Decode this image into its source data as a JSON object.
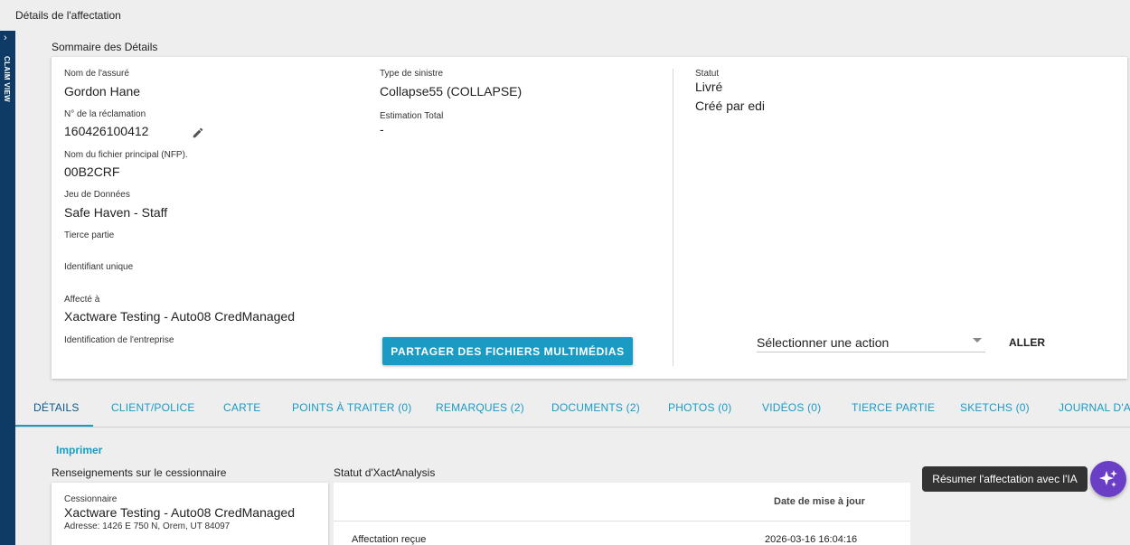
{
  "page": {
    "title": "Détails de l'affectation"
  },
  "side_rail": {
    "label": "CLAIM VIEW"
  },
  "summary": {
    "title": "Sommaire des Détails",
    "fields": {
      "insured_name": {
        "label": "Nom de l'assuré",
        "value": "Gordon Hane"
      },
      "claim_number": {
        "label": "N° de la réclamation",
        "value": "160426100412"
      },
      "nfp": {
        "label": "Nom du fichier principal (NFP).",
        "value": "00B2CRF"
      },
      "dataset": {
        "label": "Jeu de Données",
        "value": "Safe Haven - Staff"
      },
      "third_party": {
        "label": "Tierce partie",
        "value": ""
      },
      "unique_id": {
        "label": "Identifiant unique",
        "value": ""
      },
      "assigned_to": {
        "label": "Affecté à",
        "value": "Xactware Testing - Auto08 CredManaged"
      },
      "company_id": {
        "label": "Identification de l'entreprise",
        "value": ""
      },
      "loss_type": {
        "label": "Type de sinistre",
        "value": "Collapse55 (COLLAPSE)"
      },
      "estimate_total": {
        "label": "Estimation Total",
        "value": "-"
      },
      "status": {
        "label": "Statut",
        "value": "Livré"
      },
      "created_by": "Créé par edi"
    },
    "share_button": "PARTAGER DES FICHIERS MULTIMÉDIAS",
    "action_select": {
      "value": "Sélectionner une action"
    },
    "go_button": "ALLER"
  },
  "tabs": [
    {
      "label": "DÉTAILS",
      "active": true
    },
    {
      "label": "CLIENT/POLICE"
    },
    {
      "label": "CARTE"
    },
    {
      "label": "POINTS À TRAITER (0)"
    },
    {
      "label": "REMARQUES (2)"
    },
    {
      "label": "DOCUMENTS (2)"
    },
    {
      "label": "PHOTOS (0)"
    },
    {
      "label": "VIDÉOS (0)"
    },
    {
      "label": "TIERCE PARTIE"
    },
    {
      "label": "SKETCHS (0)"
    },
    {
      "label": "JOURNAL D'AC"
    }
  ],
  "print_link": "Imprimer",
  "assignee": {
    "title": "Renseignements sur le cessionnaire",
    "label": "Cessionnaire",
    "name": "Xactware Testing - Auto08 CredManaged",
    "address": "Adresse: 1426 E 750 N, Orem, UT 84097"
  },
  "xact_analysis": {
    "title": "Statut d'XactAnalysis",
    "column_date": "Date de mise à jour",
    "rows": [
      {
        "status": "Affectation reçue",
        "date": "2026-03-16 16:04:16"
      }
    ]
  },
  "ai": {
    "tooltip": "Résumer l'affectation avec l'IA",
    "accent": "#6a3fc6"
  },
  "colors": {
    "accent": "#1a9bc4",
    "rail": "#0d3b66"
  }
}
